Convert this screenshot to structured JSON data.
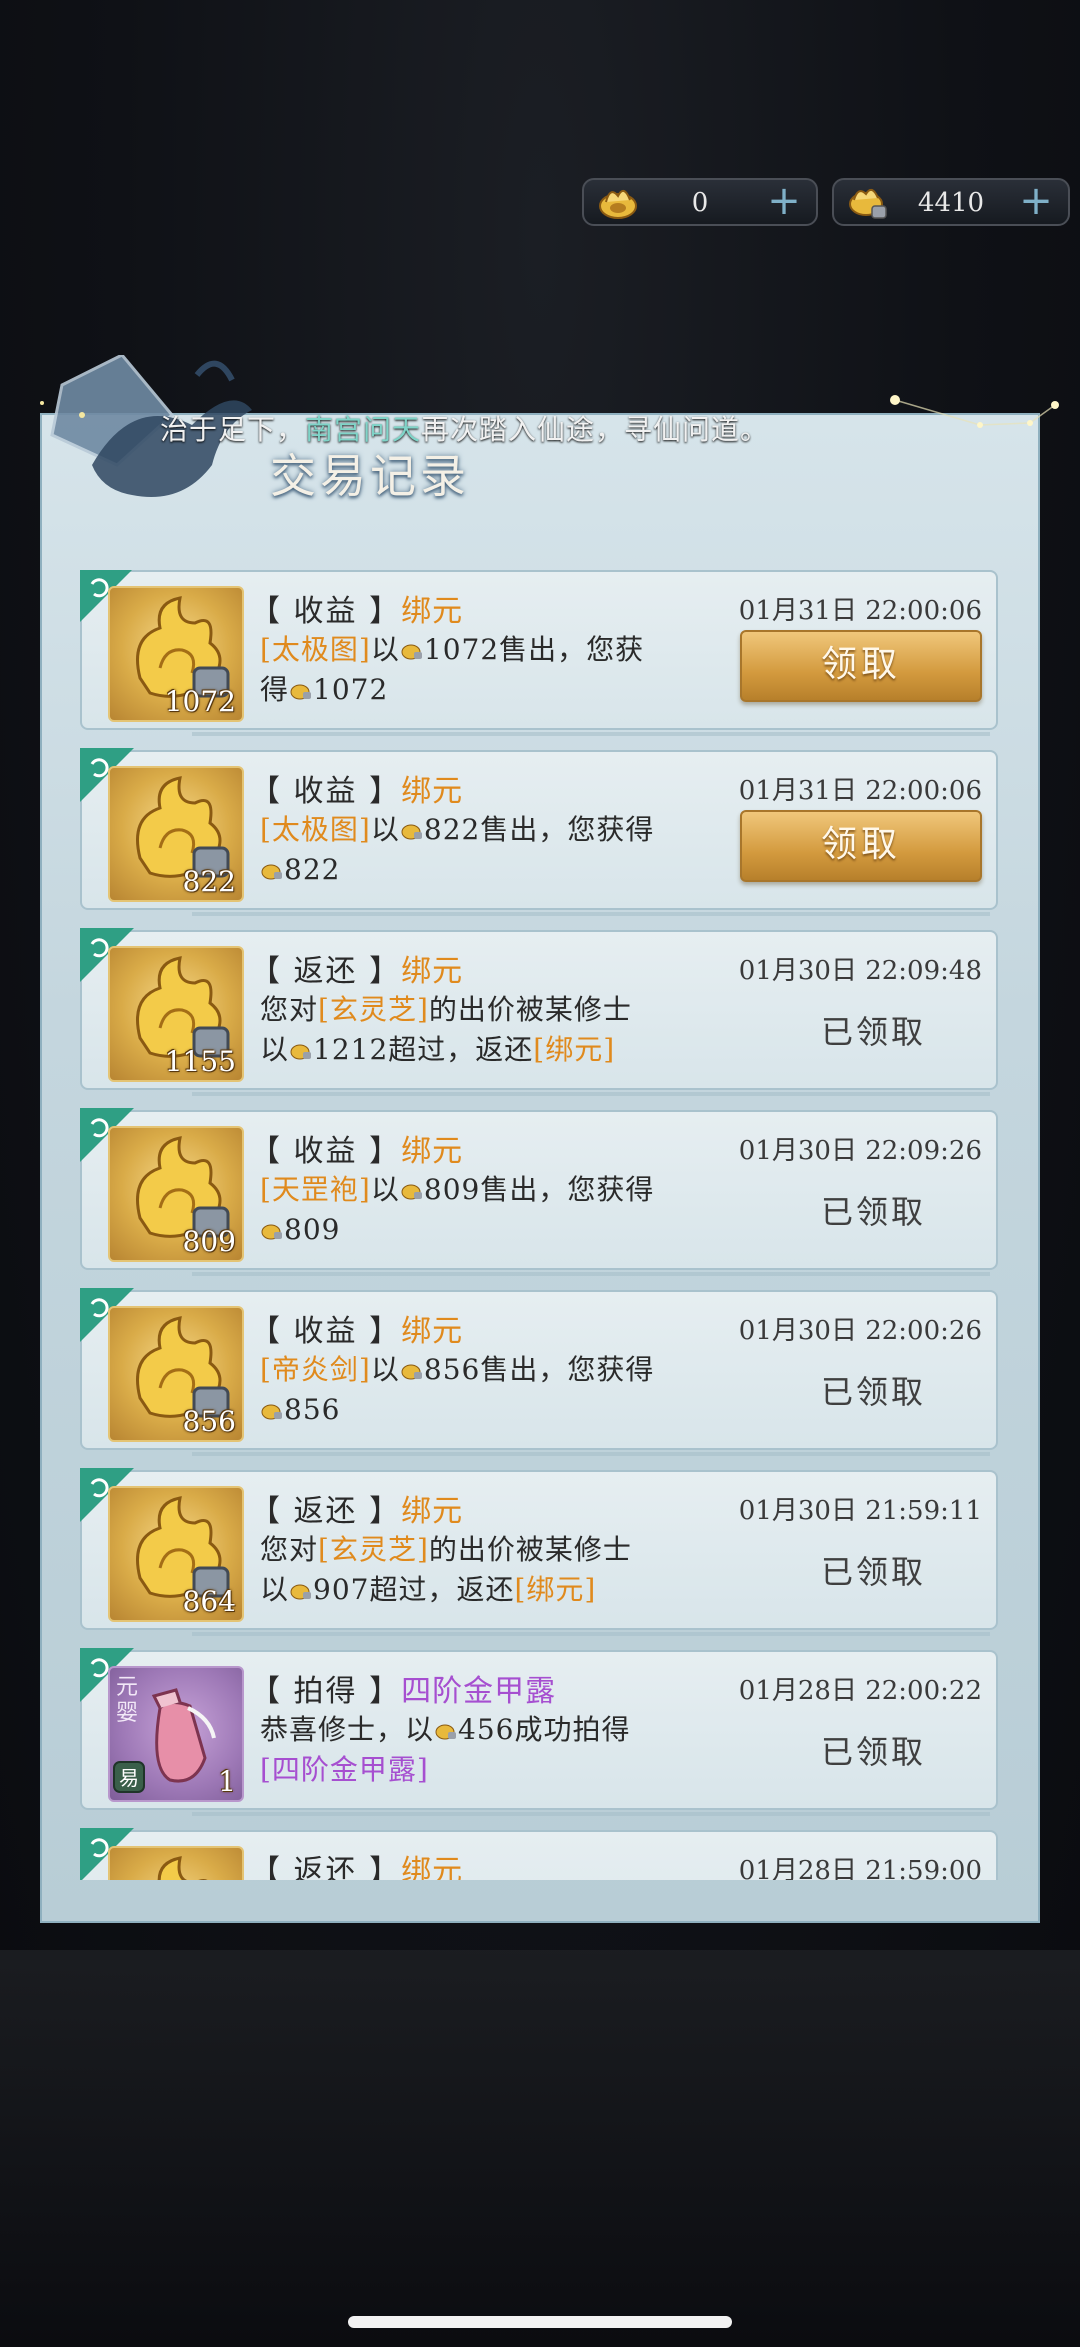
{
  "currencies": [
    {
      "icon": "gold-ingot-icon",
      "amount": "0",
      "plus": "+"
    },
    {
      "icon": "bound-gold-icon",
      "amount": "4410",
      "plus": "+"
    }
  ],
  "marquee": {
    "prefix": "治于足下，",
    "name": "南宫问天",
    "suffix": "再次踏入仙途，寻仙问道。"
  },
  "panel": {
    "title": "交易记录"
  },
  "records": [
    {
      "type_label": "【 收益 】",
      "item": "绑元",
      "date": "01月31日  22:00:06",
      "qty": "1072",
      "desc": {
        "a": "[太极图]",
        "b": "以",
        "c": "1072售出，您获",
        "d": "得",
        "e": "1072"
      },
      "status": "claim",
      "action": "领取"
    },
    {
      "type_label": "【 收益 】",
      "item": "绑元",
      "date": "01月31日  22:00:06",
      "qty": "822",
      "desc": {
        "a": "[太极图]",
        "b": "以",
        "c": "822售出，您获得",
        "d": "",
        "e": "822"
      },
      "status": "claim",
      "action": "领取"
    },
    {
      "type_label": "【 返还 】",
      "item": "绑元",
      "date": "01月30日  22:09:48",
      "qty": "1155",
      "desc": {
        "a": "您对",
        "b": "[玄灵芝]",
        "c": "的出价被某修士",
        "d": "以",
        "e": "1212超过，返还",
        "f": "[绑元]"
      },
      "status": "claimed",
      "action": "已领取"
    },
    {
      "type_label": "【 收益 】",
      "item": "绑元",
      "date": "01月30日  22:09:26",
      "qty": "809",
      "desc": {
        "a": "[天罡袍]",
        "b": "以",
        "c": "809售出，您获得",
        "d": "",
        "e": "809"
      },
      "status": "claimed",
      "action": "已领取"
    },
    {
      "type_label": "【 收益 】",
      "item": "绑元",
      "date": "01月30日  22:00:26",
      "qty": "856",
      "desc": {
        "a": "[帝炎剑]",
        "b": "以",
        "c": "856售出，您获得",
        "d": "",
        "e": "856"
      },
      "status": "claimed",
      "action": "已领取"
    },
    {
      "type_label": "【 返还 】",
      "item": "绑元",
      "date": "01月30日  21:59:11",
      "qty": "864",
      "desc": {
        "a": "您对",
        "b": "[玄灵芝]",
        "c": "的出价被某修士",
        "d": "以",
        "e": "907超过，返还",
        "f": "[绑元]"
      },
      "status": "claimed",
      "action": "已领取"
    },
    {
      "type_label": "【 拍得 】",
      "item": "四阶金甲露",
      "date": "01月28日  22:00:22",
      "qty": "1",
      "thumb_tag1": "元",
      "thumb_tag2": "婴",
      "thumb_tag3": "易",
      "desc": {
        "a": "恭喜修士，以",
        "b": "456成功拍得",
        "c": "[四阶金甲露]"
      },
      "status": "claimed",
      "action": "已领取"
    },
    {
      "type_label": "【 返还 】",
      "item": "绑元",
      "date": "01月28日  21:59:00",
      "qty": "",
      "status": "partial"
    }
  ]
}
